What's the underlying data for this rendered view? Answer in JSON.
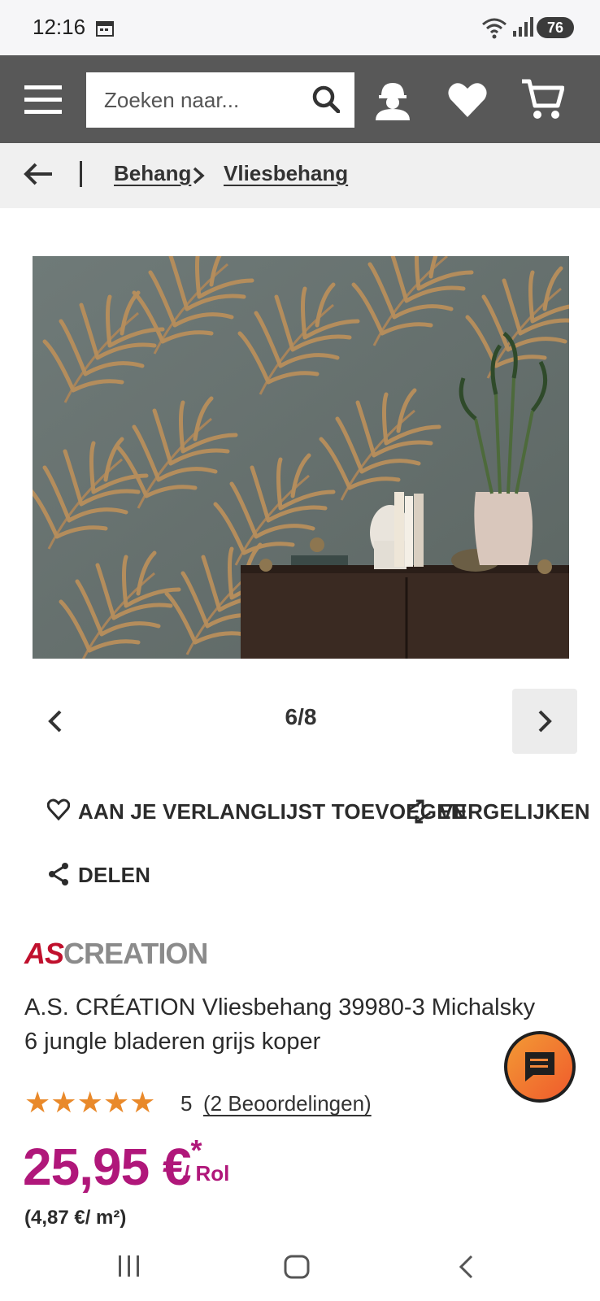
{
  "status_bar": {
    "time": "12:16",
    "battery": "76"
  },
  "header": {
    "search_placeholder": "Zoeken naar..."
  },
  "breadcrumb": {
    "items": [
      "Behang",
      "Vliesbehang"
    ]
  },
  "gallery": {
    "counter": "6/8"
  },
  "actions": {
    "wishlist": "AAN JE VERLANGLIJST TOEVOEGEN",
    "compare": "VERGELIJKEN",
    "share": "DELEN"
  },
  "brand": {
    "as": "AS",
    "creation": "CREATION"
  },
  "product": {
    "title": "A.S. CRÉATION Vliesbehang 39980-3 Michalsky 6 jungle bladeren grijs koper",
    "rating_value": "5",
    "rating_stars": 5,
    "reviews_label": "(2 Beoordelingen)",
    "price": "25,95 €",
    "price_asterisk": "*",
    "price_unit": "/ Rol",
    "price_per_sqm": "(4,87 €/ m²)"
  },
  "colors": {
    "header_bg": "#585858",
    "price": "#b0177a",
    "star": "#e9892a",
    "chat_gradient_start": "#f29a35",
    "chat_gradient_end": "#f05a2c"
  }
}
